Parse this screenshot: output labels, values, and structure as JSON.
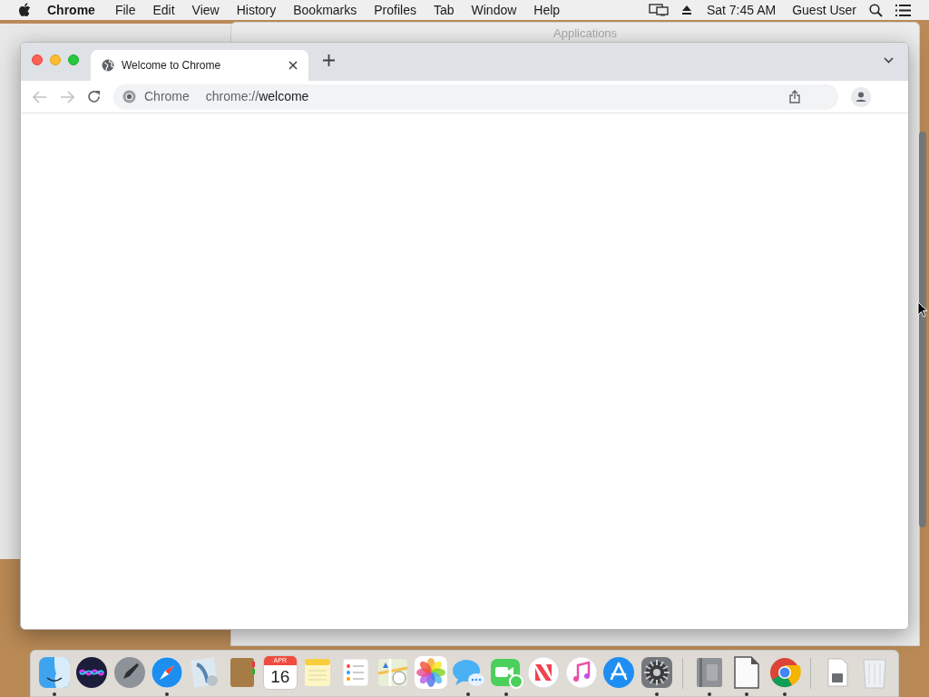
{
  "menu_bar": {
    "app": "Chrome",
    "menus": [
      "File",
      "Edit",
      "View",
      "History",
      "Bookmarks",
      "Profiles",
      "Tab",
      "Window",
      "Help"
    ],
    "clock": "Sat 7:45 AM",
    "user": "Guest User"
  },
  "background_window": {
    "title": "Applications"
  },
  "browser": {
    "tabs": [
      {
        "title": "Welcome to Chrome",
        "selected": true
      }
    ],
    "site_label": "Chrome",
    "url_scheme": "chrome://",
    "url_host": "welcome"
  },
  "dock": {
    "items": [
      {
        "kind": "finder",
        "running": true
      },
      {
        "kind": "siri",
        "running": false
      },
      {
        "kind": "launchpad",
        "running": false
      },
      {
        "kind": "safari",
        "running": true
      },
      {
        "kind": "mail",
        "running": false
      },
      {
        "kind": "contacts",
        "running": false
      },
      {
        "kind": "calendar",
        "running": false,
        "month": "APR",
        "day": "16"
      },
      {
        "kind": "notes",
        "running": false
      },
      {
        "kind": "reminders",
        "running": false
      },
      {
        "kind": "maps",
        "running": false
      },
      {
        "kind": "photos",
        "running": false
      },
      {
        "kind": "messages",
        "running": true
      },
      {
        "kind": "facetime",
        "running": true
      },
      {
        "kind": "news",
        "running": false
      },
      {
        "kind": "music",
        "running": false
      },
      {
        "kind": "appstore",
        "running": false
      },
      {
        "kind": "preferences",
        "running": true
      },
      {
        "kind": "separator"
      },
      {
        "kind": "fontbook",
        "running": true
      },
      {
        "kind": "libreoffice",
        "running": true
      },
      {
        "kind": "chrome",
        "running": true
      },
      {
        "kind": "separator"
      },
      {
        "kind": "document",
        "running": false
      },
      {
        "kind": "trash",
        "running": false
      }
    ]
  }
}
